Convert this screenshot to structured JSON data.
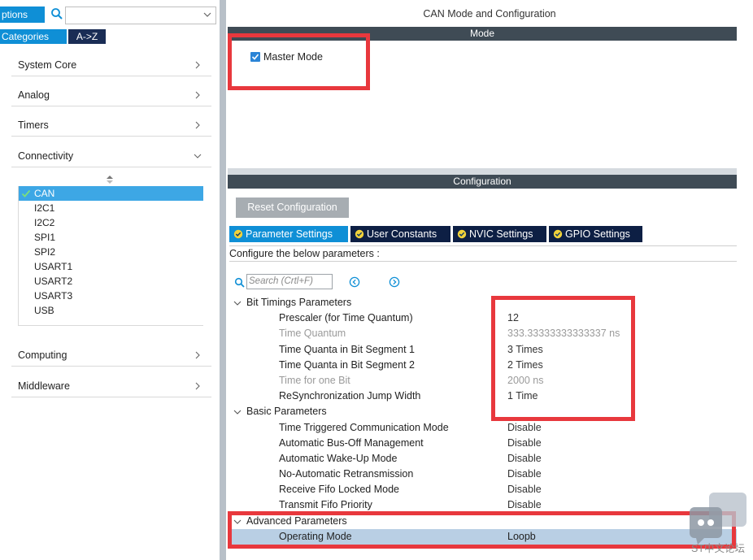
{
  "left_panel": {
    "options_label": "ptions",
    "categories_tab": "Categories",
    "az_tab": "A->Z",
    "menu": [
      {
        "label": "System Core"
      },
      {
        "label": "Analog"
      },
      {
        "label": "Timers"
      },
      {
        "label": "Connectivity"
      }
    ],
    "peripherals": [
      "CAN",
      "I2C1",
      "I2C2",
      "SPI1",
      "SPI2",
      "USART1",
      "USART2",
      "USART3",
      "USB"
    ],
    "selected_peripheral": "CAN",
    "menu_bottom": [
      {
        "label": "Computing"
      },
      {
        "label": "Middleware"
      }
    ]
  },
  "right_panel": {
    "title": "CAN Mode and Configuration",
    "mode_header": "Mode",
    "master_mode_label": "Master Mode",
    "master_mode_checked": true,
    "config_header": "Configuration",
    "reset_button": "Reset Configuration",
    "tabs": [
      "Parameter Settings",
      "User Constants",
      "NVIC Settings",
      "GPIO Settings"
    ],
    "active_tab": "Parameter Settings",
    "config_hint": "Configure the below parameters :",
    "search_placeholder": "Search (Crtl+F)",
    "groups": {
      "bit_timings": "Bit Timings Parameters",
      "basic": "Basic Parameters",
      "advanced": "Advanced Parameters"
    },
    "bit_timing_params": [
      {
        "name": "Prescaler (for Time Quantum)",
        "value": "12"
      },
      {
        "name": "Time Quantum",
        "value": "333.33333333333337 ns"
      },
      {
        "name": "Time Quanta in Bit Segment 1",
        "value": "3 Times"
      },
      {
        "name": "Time Quanta in Bit Segment 2",
        "value": "2 Times"
      },
      {
        "name": "Time for one Bit",
        "value": "2000 ns"
      },
      {
        "name": "ReSynchronization Jump Width",
        "value": "1 Time"
      }
    ],
    "basic_params": [
      {
        "name": "Time Triggered Communication Mode",
        "value": "Disable"
      },
      {
        "name": "Automatic Bus-Off Management",
        "value": "Disable"
      },
      {
        "name": "Automatic Wake-Up Mode",
        "value": "Disable"
      },
      {
        "name": "No-Automatic Retransmission",
        "value": "Disable"
      },
      {
        "name": "Receive Fifo Locked Mode",
        "value": "Disable"
      },
      {
        "name": "Transmit Fifo Priority",
        "value": "Disable"
      }
    ],
    "advanced_params": [
      {
        "name": "Operating Mode",
        "value": "Loopb"
      }
    ]
  },
  "watermark": {
    "text": "ST中文论坛"
  },
  "colors": {
    "accent_blue": "#0f8fd6",
    "dark_navy": "#0d1f44",
    "header_gray": "#3f4b55",
    "highlight_red": "#e8383d",
    "selected_row": "#b9cfe4"
  }
}
